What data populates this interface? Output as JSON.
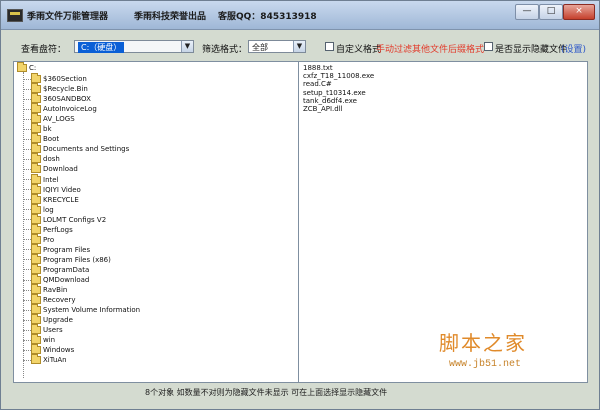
{
  "titlebar": {
    "app_title": "季雨文件万能管理器",
    "vendor": "季雨科技荣誉出品",
    "qq": "客服QQ：845313918",
    "buttons": [
      "—",
      "□",
      "×"
    ]
  },
  "toolbar": {
    "drive_label": "查看盘符：",
    "drive_value": "C:（硬盘）",
    "filter_label": "筛选格式：",
    "filter_value": "全部",
    "custom_label": "自定义格式",
    "hint": "手动过滤其他文件后缀格式",
    "show_hidden_label": "是否显示隐藏文件",
    "settings_link": "(设置)"
  },
  "tree": {
    "root": "C:",
    "items": [
      "$360Section",
      "$Recycle.Bin",
      "360SANDBOX",
      "AutoInvoiceLog",
      "AV_LOGS",
      "bk",
      "Boot",
      "Documents and Settings",
      "dosh",
      "Download",
      "Intel",
      "IQIYI Video",
      "KRECYCLE",
      "log",
      "LOLMT Configs V2",
      "PerfLogs",
      "Pro",
      "Program Files",
      "Program Files (x86)",
      "ProgramData",
      "QMDownload",
      "RavBin",
      "Recovery",
      "System Volume Information",
      "Upgrade",
      "Users",
      "win",
      "Windows",
      "XiTuAn"
    ]
  },
  "files": [
    "1888.txt",
    "cxfz_T18_11008.exe",
    "read.C#",
    "setup_t10314.exe",
    "tank_d6df4.exe",
    "ZCB_API.dll"
  ],
  "status": {
    "text": "8个对象   如数量不对则为隐藏文件未显示   可在上面选择显示隐藏文件"
  },
  "watermark": {
    "cn": "脚本之家",
    "url": "www.jb51.net"
  },
  "colors": {
    "window_bg": "#d4dbd0",
    "hint_red": "#e23a2a",
    "link_blue": "#2a55c8",
    "selection_blue": "#0a5fd6"
  }
}
